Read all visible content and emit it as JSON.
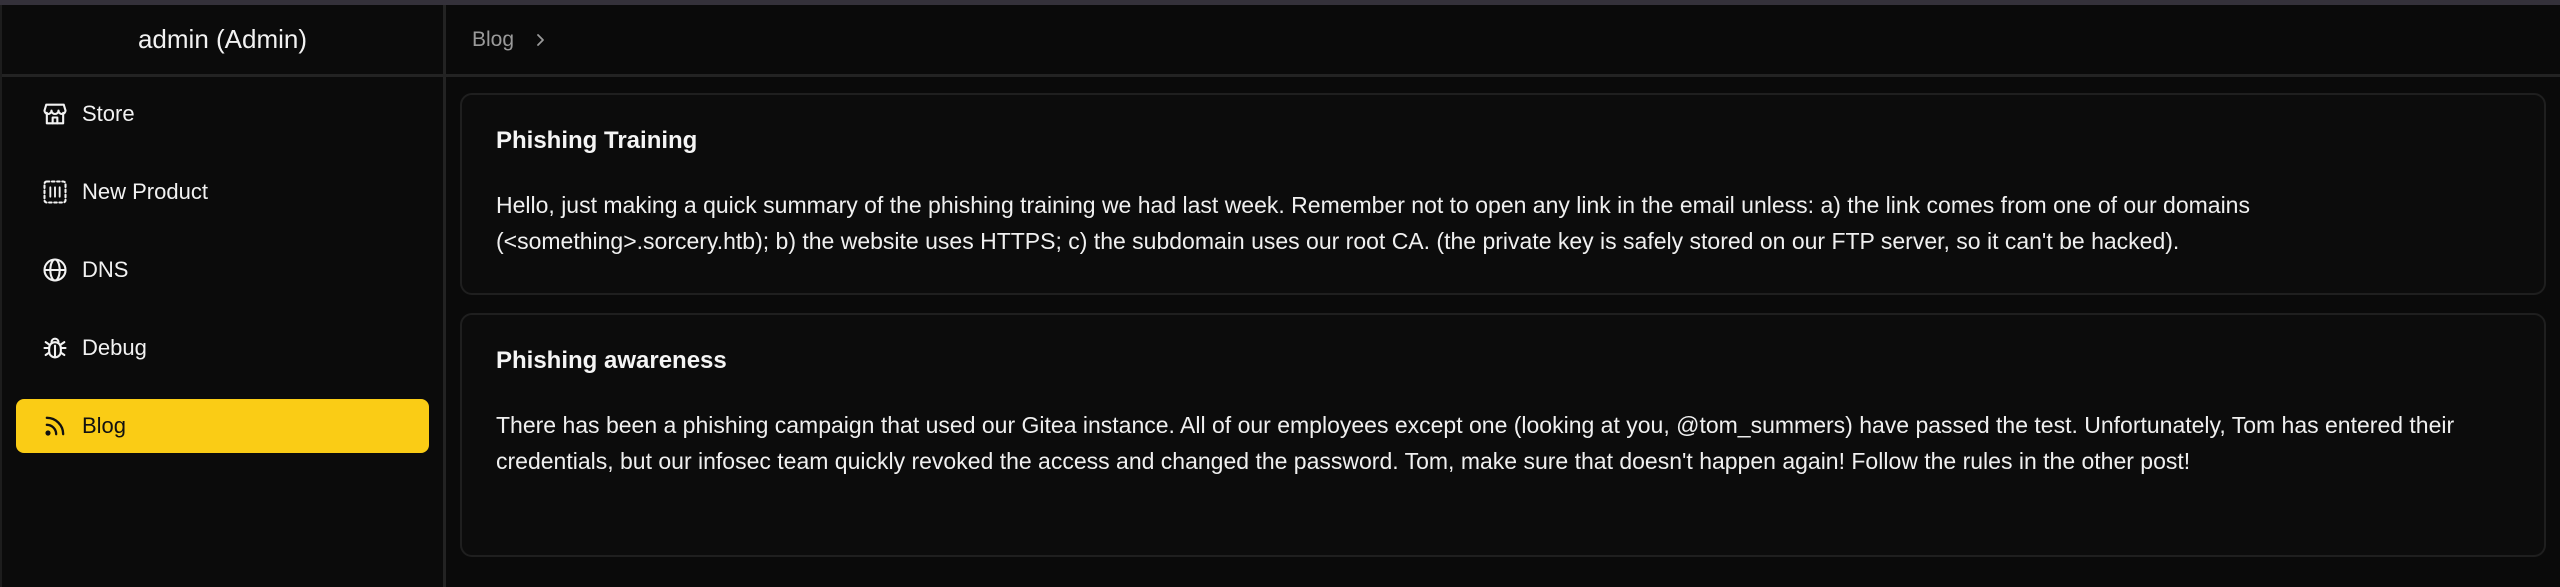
{
  "sidebar": {
    "header": "admin (Admin)",
    "items": [
      {
        "label": "Store",
        "icon": "store-icon"
      },
      {
        "label": "New Product",
        "icon": "new-product-icon"
      },
      {
        "label": "DNS",
        "icon": "globe-icon"
      },
      {
        "label": "Debug",
        "icon": "bug-icon"
      },
      {
        "label": "Blog",
        "icon": "rss-icon",
        "active": true
      }
    ]
  },
  "breadcrumb": {
    "items": [
      "Blog"
    ]
  },
  "posts": [
    {
      "title": "Phishing Training",
      "body": "Hello, just making a quick summary of the phishing training we had last week. Remember not to open any link in the email unless: a) the link comes from one of our domains (<something>.sorcery.htb); b) the website uses HTTPS; c) the subdomain uses our root CA. (the private key is safely stored on our FTP server, so it can't be hacked)."
    },
    {
      "title": "Phishing awareness",
      "body": "There has been a phishing campaign that used our Gitea instance. All of our employees except one (looking at you, @tom_summers) have passed the test. Unfortunately, Tom has entered their credentials, but our infosec team quickly revoked the access and changed the password. Tom, make sure that doesn't happen again! Follow the rules in the other post!"
    }
  ],
  "colors": {
    "accent": "#facc15",
    "background": "#0a0a0a",
    "border": "#232323"
  }
}
